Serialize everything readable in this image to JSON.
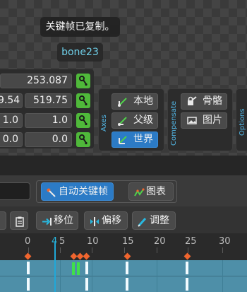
{
  "toast": {
    "text": "关键帧已复制。"
  },
  "bone_tag": {
    "text": "bone23"
  },
  "transform": {
    "rows": [
      {
        "left": "",
        "right": "253.087"
      },
      {
        "left": "9.54",
        "right": "519.75"
      },
      {
        "left": "1.0",
        "right": "1.0"
      },
      {
        "left": "0.0",
        "right": "0.0"
      }
    ]
  },
  "axes": {
    "label": "Axes",
    "options": [
      {
        "label": "本地",
        "icon": "local-axes-icon",
        "active": false
      },
      {
        "label": "父级",
        "icon": "parent-axes-icon",
        "active": false
      },
      {
        "label": "世界",
        "icon": "world-axes-icon",
        "active": true
      }
    ]
  },
  "compensate": {
    "label": "Compensate",
    "options": [
      {
        "label": "骨骼",
        "icon": "bone-lock-icon"
      },
      {
        "label": "图片",
        "icon": "image-icon"
      }
    ]
  },
  "options_label": "Options",
  "toolbar": {
    "autokey_label": "自动关键帧",
    "graph_label": "图表",
    "move_label": "移位",
    "offset_label": "偏移",
    "adjust_label": "调整"
  },
  "timeline": {
    "ticks": [
      "0",
      "4",
      "5",
      "10",
      "15",
      "20",
      "25",
      "30"
    ],
    "current_frame": "4"
  },
  "colors": {
    "accent": "#2c7bc6",
    "lock_green": "#4fb83a",
    "keyframe_orange": "#f0652e",
    "track_blue": "#4e8fa8"
  }
}
